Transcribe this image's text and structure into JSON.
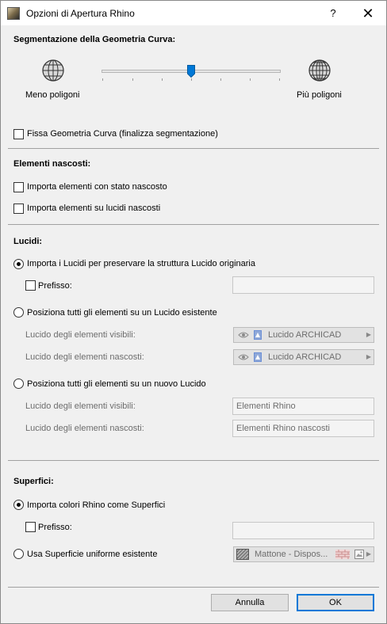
{
  "window": {
    "title": "Opzioni di Apertura Rhino",
    "help_glyph": "?",
    "close_glyph": "✕"
  },
  "segmentation": {
    "heading": "Segmentazione della Geometria Curva:",
    "less_label": "Meno poligoni",
    "more_label": "Più poligoni",
    "slider_level": 0.5,
    "fix_checkbox_label": "Fissa Geometria Curva (finalizza segmentazione)",
    "fix_checked": false
  },
  "hidden_elements": {
    "heading": "Elementi nascosti:",
    "import_hidden_label": "Importa elementi con stato nascosto",
    "import_hidden_checked": false,
    "import_hidden_layers_label": "Importa elementi su lucidi nascosti",
    "import_hidden_layers_checked": false
  },
  "layers": {
    "heading": "Lucidi:",
    "option1_label": "Importa i Lucidi per preservare la struttura Lucido originaria",
    "option1_selected": true,
    "prefix_label": "Prefisso:",
    "prefix_checked": false,
    "prefix_value": "",
    "option2_label": "Posiziona tutti gli elementi su un Lucido esistente",
    "option2_selected": false,
    "visible_label": "Lucido degli elementi visibili:",
    "visible_value": "Lucido ARCHICAD",
    "hidden_label": "Lucido degli elementi nascosti:",
    "hidden_value": "Lucido ARCHICAD",
    "option3_label": "Posiziona tutti gli elementi su un nuovo Lucido",
    "option3_selected": false,
    "new_visible_label": "Lucido degli elementi visibili:",
    "new_visible_value": "Elementi Rhino",
    "new_hidden_label": "Lucido degli elementi nascosti:",
    "new_hidden_value": "Elementi Rhino nascosti"
  },
  "surfaces": {
    "heading": "Superfici:",
    "option1_label": "Importa colori Rhino come Superfici",
    "option1_selected": true,
    "prefix_label": "Prefisso:",
    "prefix_checked": false,
    "prefix_value": "",
    "option2_label": "Usa Superficie uniforme esistente",
    "option2_selected": false,
    "surface_value": "Mattone - Dispos..."
  },
  "buttons": {
    "cancel_label": "Annulla",
    "ok_label": "OK"
  },
  "colors": {
    "accent": "#0078d7",
    "layer_icon": "#6b8fd6"
  }
}
